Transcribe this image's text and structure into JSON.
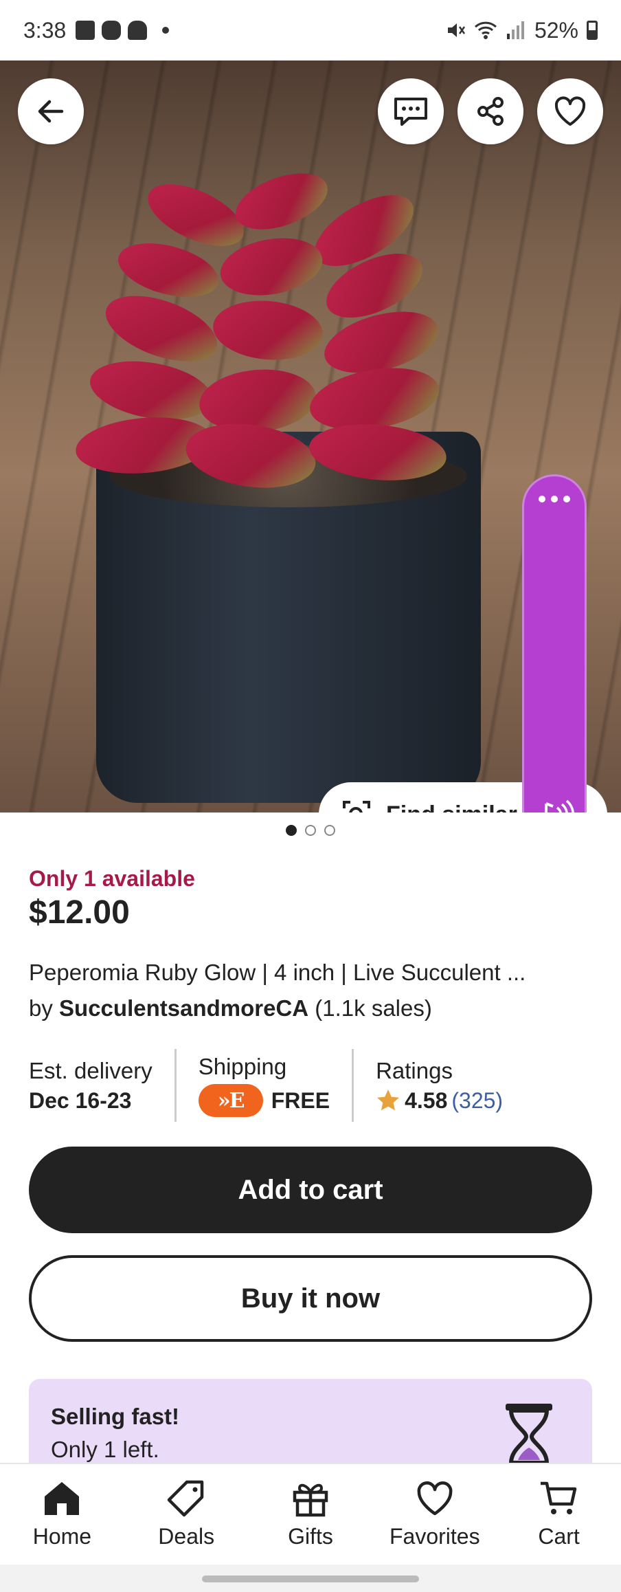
{
  "status_bar": {
    "time": "3:38",
    "battery": "52%",
    "icons": [
      "gallery-icon",
      "game-controller-icon",
      "snapchat-icon",
      "notification-dot-icon",
      "mute-icon",
      "wifi-icon",
      "signal-icon",
      "battery-icon"
    ]
  },
  "hero": {
    "image_pages": 3,
    "active_page": 1,
    "find_similar_label": "Find similar",
    "assistant_color": "#b43fd1"
  },
  "listing": {
    "availability": "Only 1 available",
    "price": "$12.00",
    "title": "Peperomia Ruby Glow | 4 inch | Live Succulent ...",
    "by_prefix": "by",
    "shop_name": "SucculentsandmoreCA",
    "sales": "(1.1k sales)"
  },
  "info": {
    "delivery_label": "Est. delivery",
    "delivery_value": "Dec 16-23",
    "shipping_label": "Shipping",
    "shipping_badge": "»E",
    "shipping_value": "FREE",
    "ratings_label": "Ratings",
    "rating_value": "4.58",
    "rating_count": "(325)"
  },
  "actions": {
    "add_to_cart": "Add to cart",
    "buy_now": "Buy it now"
  },
  "promo": {
    "heading": "Selling fast!",
    "subtext": "Only 1 left."
  },
  "nav": {
    "items": [
      {
        "label": "Home",
        "icon": "home-icon"
      },
      {
        "label": "Deals",
        "icon": "tag-icon"
      },
      {
        "label": "Gifts",
        "icon": "gift-icon"
      },
      {
        "label": "Favorites",
        "icon": "heart-icon"
      },
      {
        "label": "Cart",
        "icon": "cart-icon"
      }
    ]
  },
  "colors": {
    "availability": "#a61a4a",
    "etsy_orange": "#f1641e",
    "promo_bg": "#eadcf8",
    "primary_button": "#222222"
  }
}
